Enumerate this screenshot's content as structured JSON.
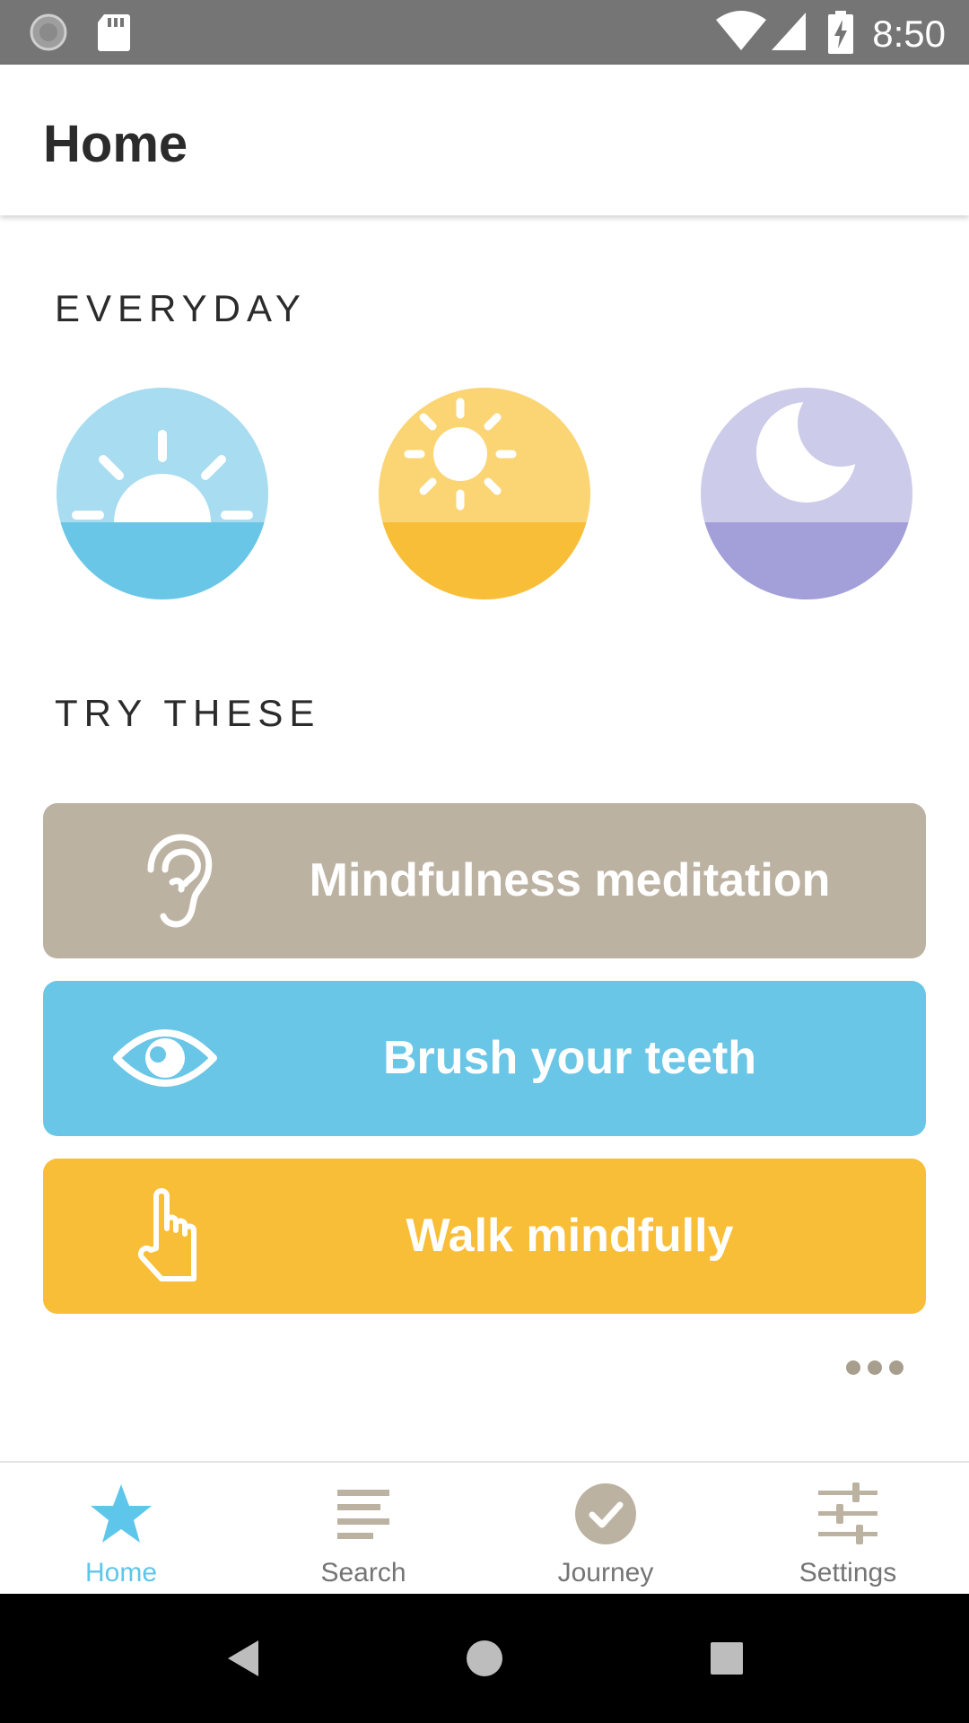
{
  "status_bar": {
    "time": "8:50",
    "icons": [
      "loading-icon",
      "sd-card-icon",
      "wifi-icon",
      "cell-signal-icon",
      "battery-charging-icon"
    ]
  },
  "app_bar": {
    "title": "Home"
  },
  "everyday": {
    "heading": "EVERYDAY",
    "items": [
      {
        "icon": "sunrise-icon",
        "top_color": "#a8dcf0",
        "bottom_color": "#6ac6e6"
      },
      {
        "icon": "sun-icon",
        "top_color": "#fbd574",
        "bottom_color": "#f8be38"
      },
      {
        "icon": "moon-icon",
        "top_color": "#cccbe9",
        "bottom_color": "#a3a0d9"
      }
    ]
  },
  "try_these": {
    "heading": "TRY THESE",
    "cards": [
      {
        "label": "Mindfulness meditation",
        "icon": "ear-icon",
        "color": "#bcb2a2"
      },
      {
        "label": "Brush your teeth",
        "icon": "eye-icon",
        "color": "#6ac6e6"
      },
      {
        "label": "Walk mindfully",
        "icon": "pointing-hand-icon",
        "color": "#f8be38"
      }
    ],
    "more_icon": "more-dots-icon"
  },
  "bottom_nav": {
    "active_color": "#5ec6ea",
    "inactive_color": "#bcb2a2",
    "items": [
      {
        "label": "Home",
        "icon": "star-icon",
        "active": true
      },
      {
        "label": "Search",
        "icon": "list-icon",
        "active": false
      },
      {
        "label": "Journey",
        "icon": "check-circle-icon",
        "active": false
      },
      {
        "label": "Settings",
        "icon": "sliders-icon",
        "active": false
      }
    ]
  },
  "system_nav": {
    "icons": [
      "back-icon",
      "home-circle-icon",
      "recents-icon"
    ]
  }
}
